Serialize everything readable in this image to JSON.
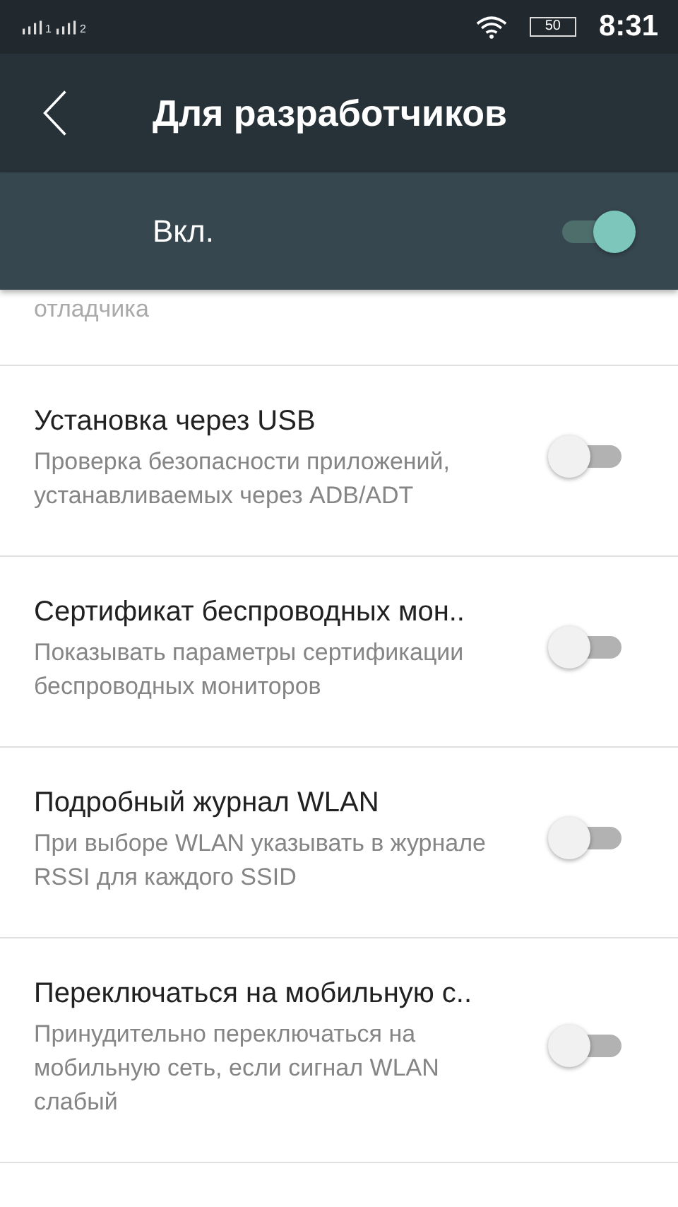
{
  "status_bar": {
    "sims": [
      "1",
      "2"
    ],
    "battery": "50",
    "time": "8:31"
  },
  "app_bar": {
    "title": "Для разработчиков"
  },
  "master_switch": {
    "label": "Вкл.",
    "on": true
  },
  "partial_item": {
    "summary": "отладчика"
  },
  "items": [
    {
      "title": "Установка через USB",
      "summary": "Проверка безопасности приложений, устанавливаемых через ADB/ADT",
      "on": false
    },
    {
      "title": "Сертификат беспроводных мон..",
      "summary": "Показывать параметры сертификации беспроводных мониторов",
      "on": false
    },
    {
      "title": "Подробный журнал WLAN",
      "summary": "При выборе WLAN указывать в журнале RSSI для каждого SSID",
      "on": false
    },
    {
      "title": "Переключаться на мобильную с..",
      "summary": "Принудительно переключаться на мобильную сеть, если сигнал WLAN слабый",
      "on": false
    }
  ]
}
